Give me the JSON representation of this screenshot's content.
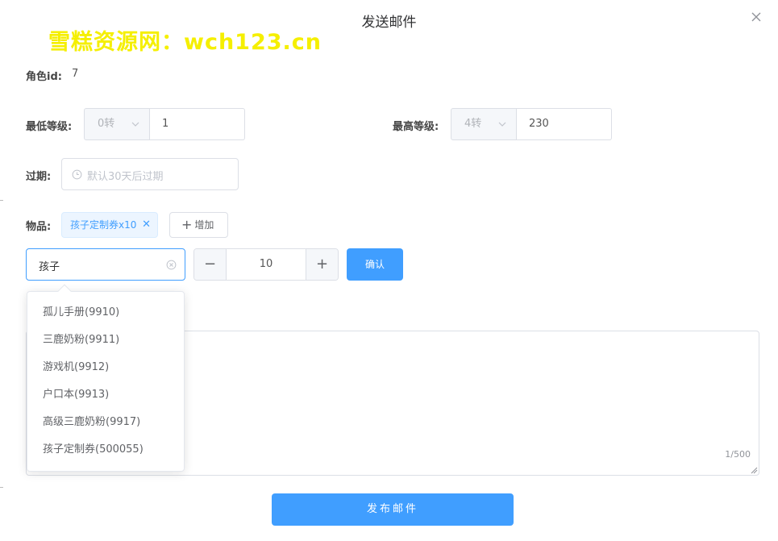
{
  "dialog": {
    "title": "发送邮件",
    "watermark": "雪糕资源网：wch123.cn"
  },
  "role": {
    "label": "角色id:",
    "value": "7"
  },
  "min_level": {
    "label": "最低等级:",
    "rebirth_select": "0转",
    "level_value": "1"
  },
  "max_level": {
    "label": "最高等级:",
    "rebirth_select": "4转",
    "level_value": "230"
  },
  "expire": {
    "label": "过期:",
    "placeholder": "默认30天后过期"
  },
  "items": {
    "label": "物品:",
    "tags": [
      "孩子定制券x10"
    ],
    "add_label": "增加"
  },
  "item_picker": {
    "search_value": "孩子",
    "quantity": "10",
    "confirm_label": "确认",
    "options": [
      "孤儿手册(9910)",
      "三鹿奶粉(9911)",
      "游戏机(9912)",
      "户口本(9913)",
      "高级三鹿奶粉(9917)",
      "孩子定制券(500055)"
    ]
  },
  "content": {
    "counter": "1/500"
  },
  "submit_label": "发布邮件",
  "colors": {
    "primary": "#409eff",
    "watermark": "#f5ef00",
    "border": "#dcdfe6"
  }
}
